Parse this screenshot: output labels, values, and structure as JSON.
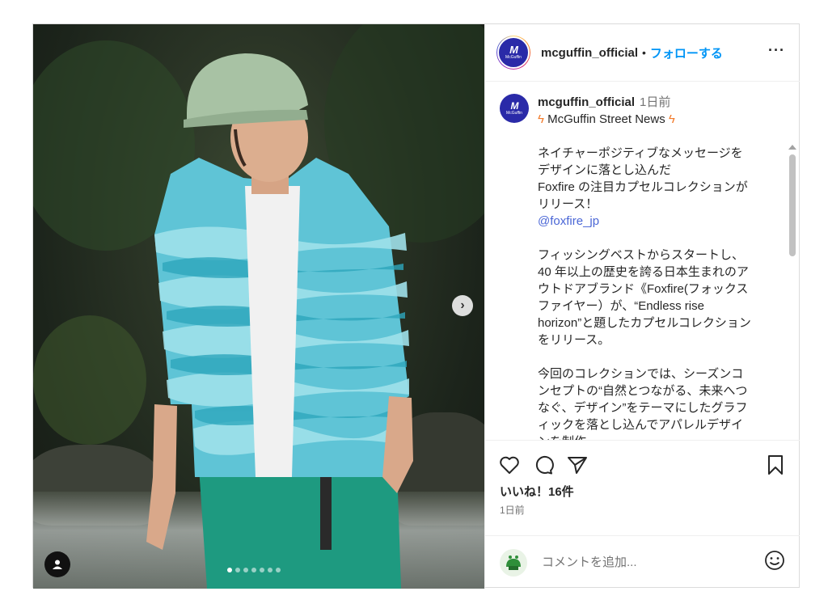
{
  "header": {
    "username": "mcguffin_official",
    "separator": "•",
    "follow_label": "フォローする",
    "more_label": "···"
  },
  "avatar": {
    "mark": "M",
    "sub": "McGuffin"
  },
  "caption": {
    "username": "mcguffin_official",
    "time": "1日前",
    "headline": "McGuffin Street News",
    "para1": [
      "ネイチャーポジティブなメッセージを",
      "デザインに落とし込んだ",
      "Foxfire の注目カプセルコレクションが",
      "リリース！"
    ],
    "mention": "@foxfire_jp",
    "para2": [
      "フィッシングベストからスタートし、",
      "40 年以上の歴史を誇る日本生まれのア",
      "ウトドアブランド《Foxfire(フォックス",
      "ファイヤー）が、“Endless rise",
      "horizon”と題したカプセルコレクション",
      "をリリース。"
    ],
    "para3": [
      "今回のコレクションでは、シーズンコ",
      "ンセプトの“自然とつながる、未来へつ",
      "なぐ、デザイン”をテーマにしたグラフ",
      "ィックを落とし込んでアパレルデザイ",
      "ンを制作。"
    ]
  },
  "actions": {
    "likes": "いいね！16件",
    "date": "1日前"
  },
  "comment": {
    "placeholder": "コメントを追加..."
  },
  "carousel": {
    "slide_count": 7,
    "active_index": 0,
    "next_label": "›"
  },
  "icons": [
    "heart-icon",
    "comment-icon",
    "share-icon",
    "bookmark-icon",
    "emoji-icon",
    "user-tag-icon",
    "more-icon"
  ],
  "colors": {
    "follow": "#0095f6",
    "mention": "#4a66d6",
    "bolt": "#f27a2a",
    "brand": "#2a2aa8"
  }
}
